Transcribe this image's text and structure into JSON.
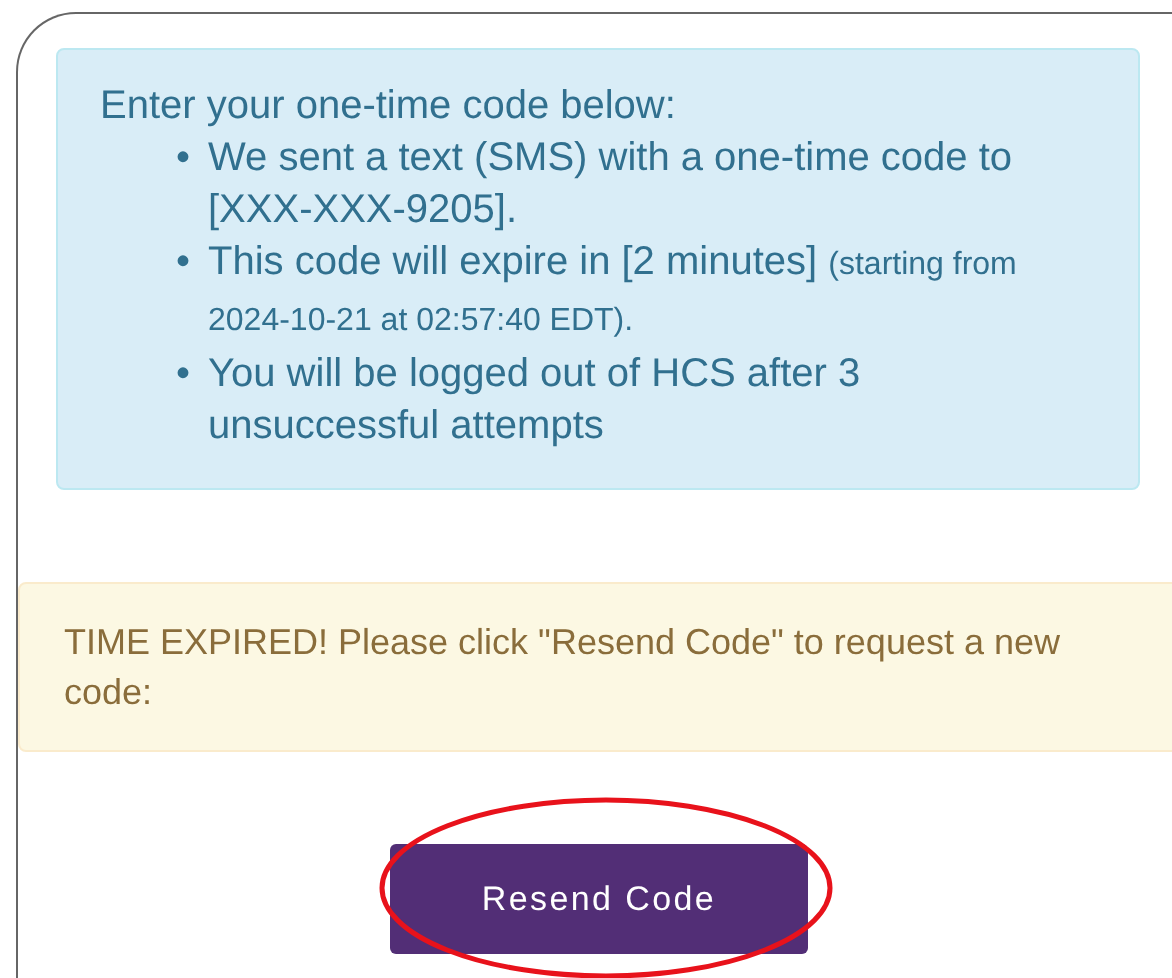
{
  "info": {
    "heading": "Enter your one-time code below:",
    "bullets": [
      {
        "marker": "•",
        "text": "We sent a text (SMS) with a one-time code to [XXX-XXX-9205]."
      },
      {
        "marker": "•",
        "text": "This code will expire in [2 minutes]",
        "note": "(starting from 2024-10-21 at 02:57:40 EDT)."
      },
      {
        "marker": "•",
        "text": "You will be logged out of HCS after 3 unsuccessful attempts"
      }
    ]
  },
  "warning": "TIME EXPIRED! Please click \"Resend Code\" to request a new code:",
  "button": "Resend Code"
}
